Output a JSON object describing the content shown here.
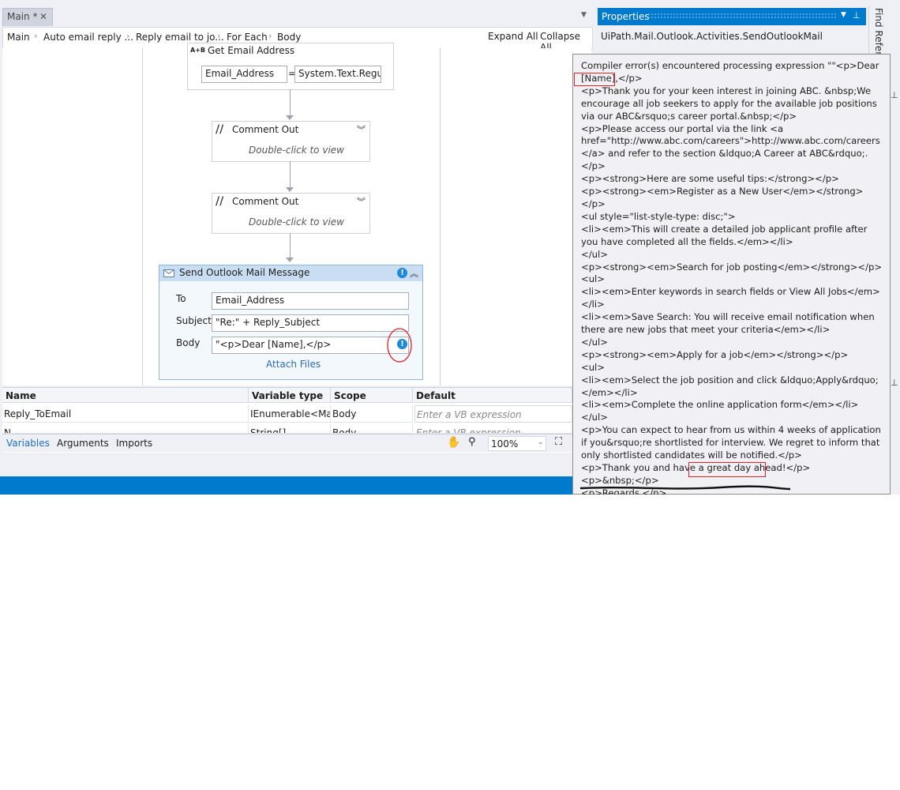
{
  "tabs": {
    "main_label": "Main *",
    "close_symbol": "✕"
  },
  "breadcrumb": {
    "items": [
      "Main",
      "Auto email reply ...",
      "Reply email to jo...",
      "For Each",
      "Body"
    ],
    "separator": "›",
    "expand_all": "Expand All",
    "collapse_all": "Collapse All"
  },
  "workflow": {
    "assign": {
      "icon_text": "A+B",
      "title": "Get Email Address",
      "left_value": "Email_Address",
      "operator": "=",
      "right_value": "System.Text.Regula"
    },
    "comment1": {
      "title": "Comment Out",
      "hint": "Double-click to view"
    },
    "comment2": {
      "title": "Comment Out",
      "hint": "Double-click to view"
    },
    "mail": {
      "title": "Send Outlook Mail Message",
      "to_label": "To",
      "to_value": "Email_Address",
      "subject_label": "Subject",
      "subject_value": "\"Re:\" + Reply_Subject",
      "body_label": "Body",
      "body_value": "\"<p>Dear [Name],</p>",
      "attach_label": "Attach Files"
    }
  },
  "variables": {
    "headers": [
      "Name",
      "Variable type",
      "Scope",
      "Default"
    ],
    "rows": [
      {
        "name": "Reply_ToEmail",
        "type": "IEnumerable<Matcl",
        "scope": "Body",
        "default": "Enter a VB expression"
      },
      {
        "name": "N...",
        "type": "String[]",
        "scope": "Body",
        "default": "Enter a VB expression"
      }
    ],
    "tabs": [
      "Variables",
      "Arguments",
      "Imports"
    ],
    "zoom": "100%"
  },
  "properties": {
    "title": "Properties",
    "activity": "UiPath.Mail.Outlook.Activities.SendOutlookMail"
  },
  "side_panel": {
    "label": "Find Refere"
  },
  "error": {
    "text": "Compiler error(s) encountered processing expression \"\"<p>Dear\n[Name],</p>\n<p>Thank you for your keen interest in joining ABC. &nbsp;We encourage all job seekers to apply for the available job positions via our ABC&rsquo;s career portal.&nbsp;</p>\n<p>Please access our portal via the link <a href=\"http://www.abc.com/careers\">http://www.abc.com/careers</a> and refer to the section &ldquo;A Career at ABC&rdquo;.</p>\n<p><strong>Here are some useful tips:</strong></p>\n<p><strong><em>Register as a New User</em></strong></p>\n<ul style=\"list-style-type: disc;\">\n<li><em>This will create a detailed job applicant profile after you have completed all the fields.</em></li>\n</ul>\n<p><strong><em>Search for job posting</em></strong></p>\n<ul>\n<li><em>Enter keywords in search fields or View All Jobs</em></li>\n<li><em>Save Search: You will receive email notification when there are new jobs that meet your criteria</em></li>\n</ul>\n<p><strong><em>Apply for a job</em></strong></p>\n<ul>\n<li><em>Select the job position and click &ldquo;Apply&rdquo;</em></li>\n<li><em>Complete the online application form</em></li>\n</ul>\n<p>You can expect to hear from us within 4 weeks of application if you&rsquo;re shortlisted for interview. We regret to inform that only shortlisted candidates will be notified.</p>\n<p>Thank you and have a great day ahead!</p>\n<p>&nbsp;</p>\n<p>Regards,</p>\n<p>HR People Ops</p>\" + mail.Body\".\nString constants must end with a double quote."
  },
  "colors": {
    "accent": "#007acc",
    "annotation_red": "#e0212a",
    "warning_blue": "#1e8ad6"
  }
}
